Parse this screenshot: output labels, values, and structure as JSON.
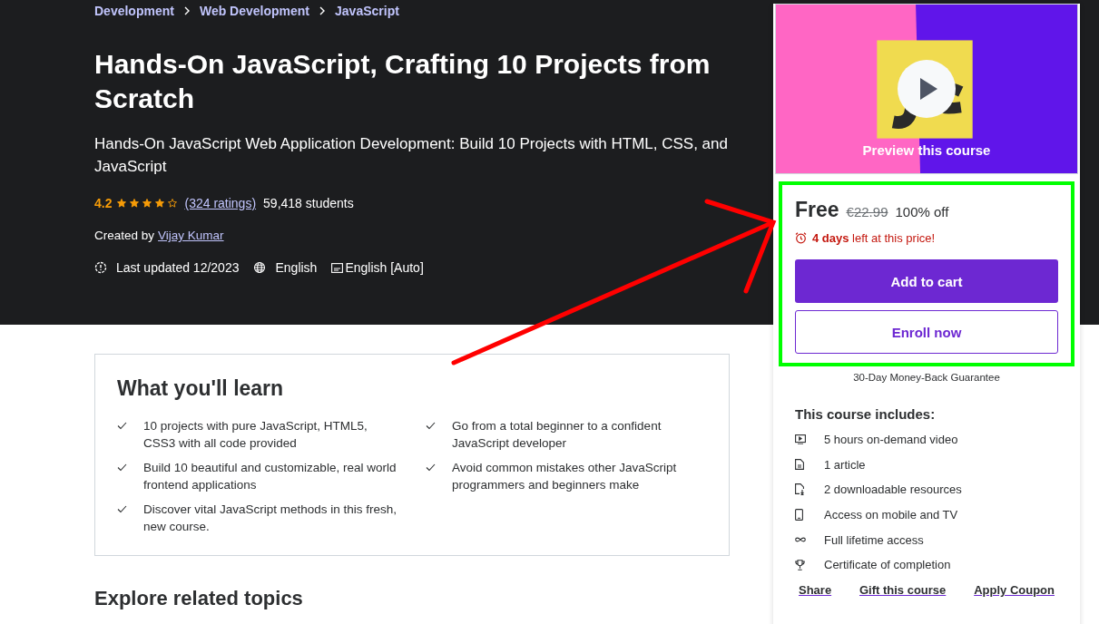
{
  "breadcrumbs": [
    "Development",
    "Web Development",
    "JavaScript"
  ],
  "title": "Hands-On JavaScript, Crafting 10 Projects from Scratch",
  "subtitle": "Hands-On JavaScript Web Application Development: Build 10 Projects with HTML, CSS, and JavaScript",
  "rating": {
    "value": "4.2",
    "stars": 4,
    "ratings_link": "(324 ratings)",
    "students": "59,418 students"
  },
  "creator": {
    "label": "Created by",
    "name": "Vijay Kumar"
  },
  "meta": {
    "updated": "Last updated 12/2023",
    "language": "English",
    "captions": "English [Auto]"
  },
  "learn": {
    "heading": "What you'll learn",
    "items": [
      {
        "text": "10 projects with pure JavaScript, HTML5, CSS3 with all code provided"
      },
      {
        "text": "Go from a total beginner to a confident JavaScript developer"
      },
      {
        "text": "Build 10 beautiful and customizable, real world frontend applications"
      },
      {
        "text": "Avoid common mistakes other JavaScript programmers and beginners make"
      },
      {
        "text": "Discover vital JavaScript methods in this fresh, new course."
      }
    ]
  },
  "related_heading": "Explore related topics",
  "sidebar": {
    "preview": {
      "kind": "picture",
      "label": "Preview this course"
    },
    "price": "Free",
    "original_price": "€22.99",
    "discount": "100% off",
    "deadline": "**4 days** left at this price!",
    "add_to_cart": "Add to cart",
    "enroll": "Enroll now",
    "guarantee": "30-Day Money-Back Guarantee",
    "includes_heading": "This course includes:",
    "includes": [
      {
        "kind": "video",
        "text": "5 hours on-demand video"
      },
      {
        "kind": "article",
        "text": "1 article"
      },
      {
        "kind": "download",
        "text": "2 downloadable resources"
      },
      {
        "kind": "mobile",
        "text": "Access on mobile and TV"
      },
      {
        "kind": "infinity",
        "text": "Full lifetime access"
      },
      {
        "kind": "trophy",
        "text": "Certificate of completion"
      }
    ],
    "links": [
      "Share",
      "Gift this course",
      "Apply Coupon"
    ]
  }
}
